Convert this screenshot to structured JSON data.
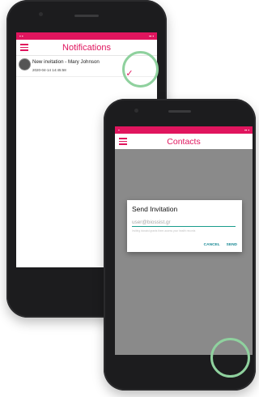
{
  "notifications_screen": {
    "title": "Notifications",
    "items": [
      {
        "title": "New invitation - Mary Johnson",
        "date": "2020-04-14 14:45:58",
        "action_icon": "checkmark-icon"
      }
    ]
  },
  "contacts_screen": {
    "title": "Contacts",
    "dialog": {
      "title": "Send Invitation",
      "input_placeholder": "user@biossist.gr",
      "hint": "Inviting biossist grants them access your health records",
      "cancel_label": "CANCEL",
      "send_label": "SEND"
    },
    "fab_icon": "add-person-icon"
  },
  "colors": {
    "accent": "#e0155e",
    "fab": "#8c1735",
    "dialog_button": "#1a8a95",
    "highlight_ring": "#8fd19e",
    "overlay": "#8a8a8a"
  }
}
